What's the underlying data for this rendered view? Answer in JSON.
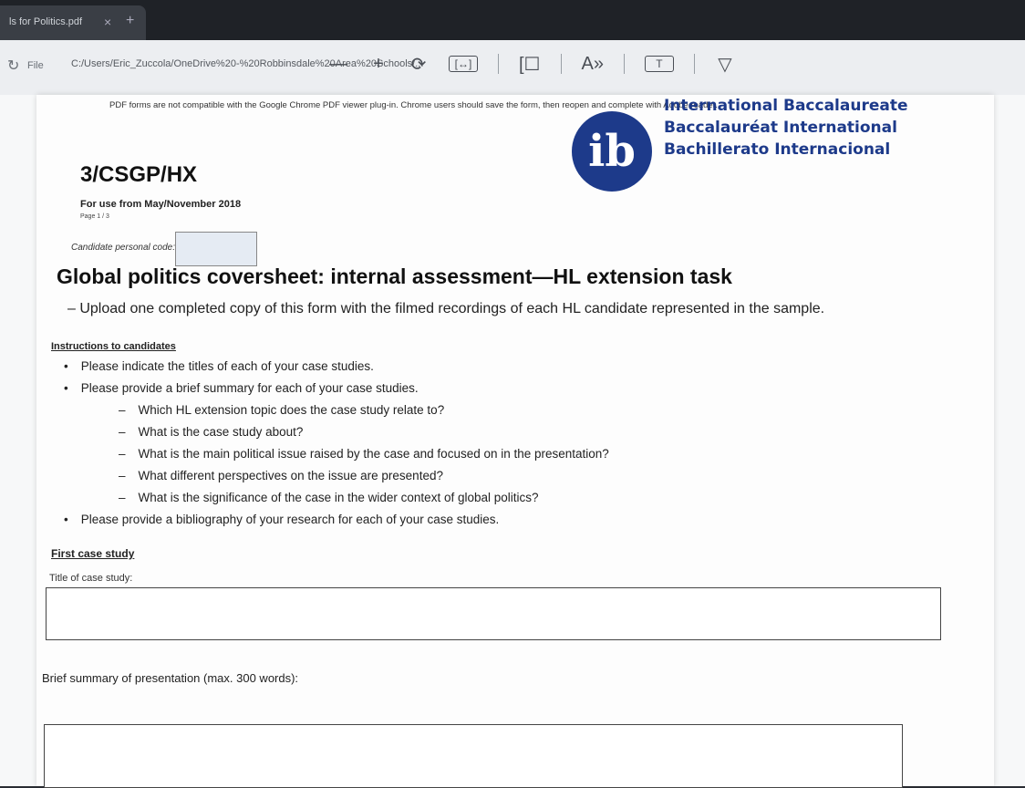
{
  "browser": {
    "tab_label": "ls for Politics.pdf",
    "tab_close": "×",
    "tab_new": "+",
    "file_label": "File",
    "url": "C:/Users/Eric_Zuccola/OneDrive%20-%20Robbinsdale%20Area%20Schools/..."
  },
  "toolbar": {
    "zoom_out": "—",
    "zoom_in": "+",
    "rotate_icon": "⟳",
    "fit_icon": "[↔]",
    "view_icon": "[☐",
    "read_aloud": "A»",
    "text_icon": "T",
    "draw_icon": "▽"
  },
  "document": {
    "notice": "PDF forms are not compatible with the Google Chrome PDF viewer plug-in. Chrome users should save the form, then reopen and complete with Adobe reader.",
    "ib_lines": [
      "International Baccalaureate",
      "Baccalauréat International",
      "Bachillerato Internacional"
    ],
    "ib_logo_text": "ib",
    "form_code": "3/CSGP/HX",
    "use_from": "For use from May/November 2018",
    "page_no": "Page 1 / 3",
    "candidate_code_label": "Candidate personal code:",
    "main_title": "Global politics coversheet: internal assessment—HL extension task",
    "upload_line": "–  Upload one completed copy of this form with the filmed recordings of each HL candidate represented in the sample.",
    "instructions_heading": "Instructions to candidates",
    "instructions": [
      {
        "level": "top",
        "text": "Please indicate the titles of each of your case studies."
      },
      {
        "level": "top",
        "text": "Please provide a brief summary for each of your case studies."
      },
      {
        "level": "sub",
        "text": "Which HL extension topic does the case study relate to?"
      },
      {
        "level": "sub",
        "text": "What is the case study about?"
      },
      {
        "level": "sub",
        "text": "What is the main political issue raised by the case and focused on in the presentation?"
      },
      {
        "level": "sub",
        "text": "What different perspectives on the issue are presented?"
      },
      {
        "level": "sub",
        "text": "What is the significance of the case in the wider context of global politics?"
      },
      {
        "level": "top",
        "text": "Please provide a bibliography of your research for each of your case studies."
      }
    ],
    "first_case_heading": "First case study",
    "title_label": "Title of case study:",
    "summary_label": "Brief summary of presentation (max. 300 words):"
  },
  "colors": {
    "ib_blue": "#1d3a8a"
  }
}
